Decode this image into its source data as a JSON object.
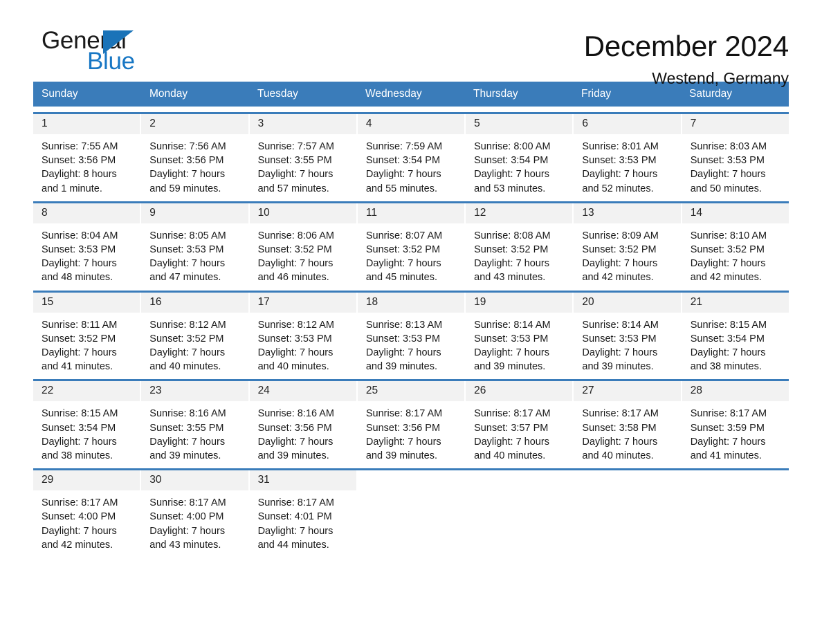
{
  "brand": {
    "name_part1": "General",
    "name_part2": "Blue"
  },
  "header": {
    "month_title": "December 2024",
    "location": "Westend, Germany"
  },
  "colors": {
    "header_blue": "#3a7cba",
    "brand_blue": "#1877c4",
    "daynum_band": "#f2f2f2"
  },
  "calendar": {
    "weekdays": [
      "Sunday",
      "Monday",
      "Tuesday",
      "Wednesday",
      "Thursday",
      "Friday",
      "Saturday"
    ],
    "weeks": [
      [
        {
          "day": "1",
          "sunrise": "Sunrise: 7:55 AM",
          "sunset": "Sunset: 3:56 PM",
          "daylight1": "Daylight: 8 hours",
          "daylight2": "and 1 minute."
        },
        {
          "day": "2",
          "sunrise": "Sunrise: 7:56 AM",
          "sunset": "Sunset: 3:56 PM",
          "daylight1": "Daylight: 7 hours",
          "daylight2": "and 59 minutes."
        },
        {
          "day": "3",
          "sunrise": "Sunrise: 7:57 AM",
          "sunset": "Sunset: 3:55 PM",
          "daylight1": "Daylight: 7 hours",
          "daylight2": "and 57 minutes."
        },
        {
          "day": "4",
          "sunrise": "Sunrise: 7:59 AM",
          "sunset": "Sunset: 3:54 PM",
          "daylight1": "Daylight: 7 hours",
          "daylight2": "and 55 minutes."
        },
        {
          "day": "5",
          "sunrise": "Sunrise: 8:00 AM",
          "sunset": "Sunset: 3:54 PM",
          "daylight1": "Daylight: 7 hours",
          "daylight2": "and 53 minutes."
        },
        {
          "day": "6",
          "sunrise": "Sunrise: 8:01 AM",
          "sunset": "Sunset: 3:53 PM",
          "daylight1": "Daylight: 7 hours",
          "daylight2": "and 52 minutes."
        },
        {
          "day": "7",
          "sunrise": "Sunrise: 8:03 AM",
          "sunset": "Sunset: 3:53 PM",
          "daylight1": "Daylight: 7 hours",
          "daylight2": "and 50 minutes."
        }
      ],
      [
        {
          "day": "8",
          "sunrise": "Sunrise: 8:04 AM",
          "sunset": "Sunset: 3:53 PM",
          "daylight1": "Daylight: 7 hours",
          "daylight2": "and 48 minutes."
        },
        {
          "day": "9",
          "sunrise": "Sunrise: 8:05 AM",
          "sunset": "Sunset: 3:53 PM",
          "daylight1": "Daylight: 7 hours",
          "daylight2": "and 47 minutes."
        },
        {
          "day": "10",
          "sunrise": "Sunrise: 8:06 AM",
          "sunset": "Sunset: 3:52 PM",
          "daylight1": "Daylight: 7 hours",
          "daylight2": "and 46 minutes."
        },
        {
          "day": "11",
          "sunrise": "Sunrise: 8:07 AM",
          "sunset": "Sunset: 3:52 PM",
          "daylight1": "Daylight: 7 hours",
          "daylight2": "and 45 minutes."
        },
        {
          "day": "12",
          "sunrise": "Sunrise: 8:08 AM",
          "sunset": "Sunset: 3:52 PM",
          "daylight1": "Daylight: 7 hours",
          "daylight2": "and 43 minutes."
        },
        {
          "day": "13",
          "sunrise": "Sunrise: 8:09 AM",
          "sunset": "Sunset: 3:52 PM",
          "daylight1": "Daylight: 7 hours",
          "daylight2": "and 42 minutes."
        },
        {
          "day": "14",
          "sunrise": "Sunrise: 8:10 AM",
          "sunset": "Sunset: 3:52 PM",
          "daylight1": "Daylight: 7 hours",
          "daylight2": "and 42 minutes."
        }
      ],
      [
        {
          "day": "15",
          "sunrise": "Sunrise: 8:11 AM",
          "sunset": "Sunset: 3:52 PM",
          "daylight1": "Daylight: 7 hours",
          "daylight2": "and 41 minutes."
        },
        {
          "day": "16",
          "sunrise": "Sunrise: 8:12 AM",
          "sunset": "Sunset: 3:52 PM",
          "daylight1": "Daylight: 7 hours",
          "daylight2": "and 40 minutes."
        },
        {
          "day": "17",
          "sunrise": "Sunrise: 8:12 AM",
          "sunset": "Sunset: 3:53 PM",
          "daylight1": "Daylight: 7 hours",
          "daylight2": "and 40 minutes."
        },
        {
          "day": "18",
          "sunrise": "Sunrise: 8:13 AM",
          "sunset": "Sunset: 3:53 PM",
          "daylight1": "Daylight: 7 hours",
          "daylight2": "and 39 minutes."
        },
        {
          "day": "19",
          "sunrise": "Sunrise: 8:14 AM",
          "sunset": "Sunset: 3:53 PM",
          "daylight1": "Daylight: 7 hours",
          "daylight2": "and 39 minutes."
        },
        {
          "day": "20",
          "sunrise": "Sunrise: 8:14 AM",
          "sunset": "Sunset: 3:53 PM",
          "daylight1": "Daylight: 7 hours",
          "daylight2": "and 39 minutes."
        },
        {
          "day": "21",
          "sunrise": "Sunrise: 8:15 AM",
          "sunset": "Sunset: 3:54 PM",
          "daylight1": "Daylight: 7 hours",
          "daylight2": "and 38 minutes."
        }
      ],
      [
        {
          "day": "22",
          "sunrise": "Sunrise: 8:15 AM",
          "sunset": "Sunset: 3:54 PM",
          "daylight1": "Daylight: 7 hours",
          "daylight2": "and 38 minutes."
        },
        {
          "day": "23",
          "sunrise": "Sunrise: 8:16 AM",
          "sunset": "Sunset: 3:55 PM",
          "daylight1": "Daylight: 7 hours",
          "daylight2": "and 39 minutes."
        },
        {
          "day": "24",
          "sunrise": "Sunrise: 8:16 AM",
          "sunset": "Sunset: 3:56 PM",
          "daylight1": "Daylight: 7 hours",
          "daylight2": "and 39 minutes."
        },
        {
          "day": "25",
          "sunrise": "Sunrise: 8:17 AM",
          "sunset": "Sunset: 3:56 PM",
          "daylight1": "Daylight: 7 hours",
          "daylight2": "and 39 minutes."
        },
        {
          "day": "26",
          "sunrise": "Sunrise: 8:17 AM",
          "sunset": "Sunset: 3:57 PM",
          "daylight1": "Daylight: 7 hours",
          "daylight2": "and 40 minutes."
        },
        {
          "day": "27",
          "sunrise": "Sunrise: 8:17 AM",
          "sunset": "Sunset: 3:58 PM",
          "daylight1": "Daylight: 7 hours",
          "daylight2": "and 40 minutes."
        },
        {
          "day": "28",
          "sunrise": "Sunrise: 8:17 AM",
          "sunset": "Sunset: 3:59 PM",
          "daylight1": "Daylight: 7 hours",
          "daylight2": "and 41 minutes."
        }
      ],
      [
        {
          "day": "29",
          "sunrise": "Sunrise: 8:17 AM",
          "sunset": "Sunset: 4:00 PM",
          "daylight1": "Daylight: 7 hours",
          "daylight2": "and 42 minutes."
        },
        {
          "day": "30",
          "sunrise": "Sunrise: 8:17 AM",
          "sunset": "Sunset: 4:00 PM",
          "daylight1": "Daylight: 7 hours",
          "daylight2": "and 43 minutes."
        },
        {
          "day": "31",
          "sunrise": "Sunrise: 8:17 AM",
          "sunset": "Sunset: 4:01 PM",
          "daylight1": "Daylight: 7 hours",
          "daylight2": "and 44 minutes."
        },
        {
          "day": "",
          "sunrise": "",
          "sunset": "",
          "daylight1": "",
          "daylight2": ""
        },
        {
          "day": "",
          "sunrise": "",
          "sunset": "",
          "daylight1": "",
          "daylight2": ""
        },
        {
          "day": "",
          "sunrise": "",
          "sunset": "",
          "daylight1": "",
          "daylight2": ""
        },
        {
          "day": "",
          "sunrise": "",
          "sunset": "",
          "daylight1": "",
          "daylight2": ""
        }
      ]
    ]
  }
}
